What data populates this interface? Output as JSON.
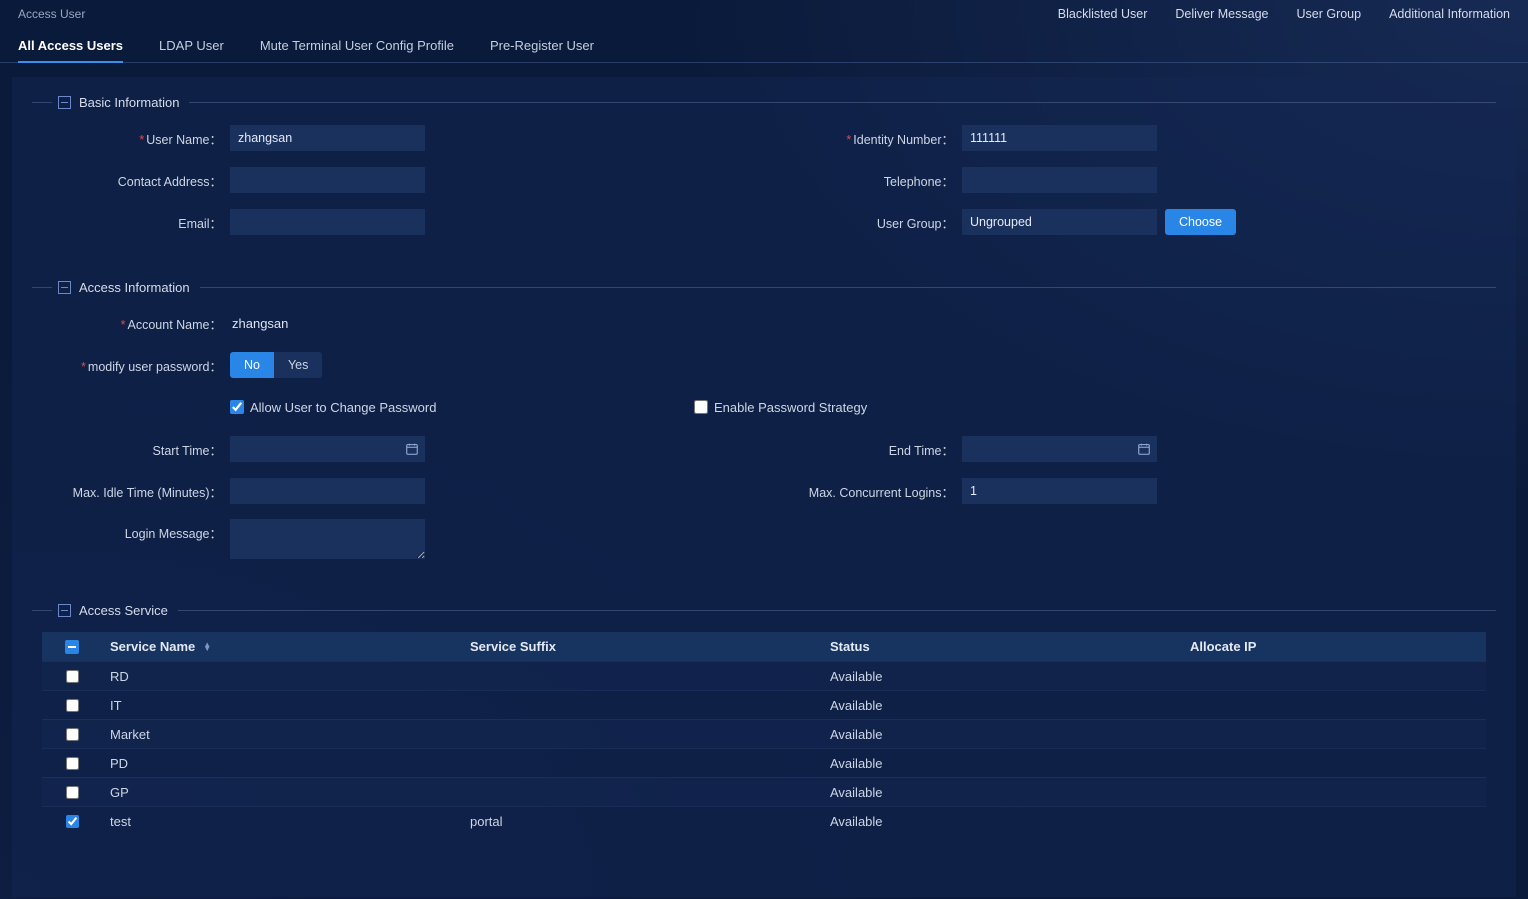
{
  "header": {
    "title": "Access User",
    "links": [
      "Blacklisted User",
      "Deliver Message",
      "User Group",
      "Additional Information"
    ]
  },
  "tabs": [
    "All Access Users",
    "LDAP User",
    "Mute Terminal User Config Profile",
    "Pre-Register User"
  ],
  "activeTab": 0,
  "sections": {
    "basic": {
      "legend": "Basic Information",
      "userNameLabel": "User Name：",
      "userName": "zhangsan",
      "identityLabel": "Identity Number：",
      "identity": "111111",
      "contactLabel": "Contact Address：",
      "contact": "",
      "telLabel": "Telephone：",
      "tel": "",
      "emailLabel": "Email：",
      "email": "",
      "groupLabel": "User Group：",
      "group": "Ungrouped",
      "chooseLabel": "Choose"
    },
    "access": {
      "legend": "Access Information",
      "accountLabel": "Account Name：",
      "account": "zhangsan",
      "modifyLabel": "modify user password：",
      "noLabel": "No",
      "yesLabel": "Yes",
      "allowChangeLabel": "Allow User to Change Password",
      "enableStrategyLabel": "Enable Password Strategy",
      "startLabel": "Start Time：",
      "start": "",
      "endLabel": "End Time：",
      "end": "",
      "maxIdleLabel": "Max. Idle Time (Minutes)：",
      "maxIdle": "",
      "maxConcLabel": "Max. Concurrent Logins：",
      "maxConc": "1",
      "loginMsgLabel": "Login Message：",
      "loginMsg": ""
    },
    "service": {
      "legend": "Access Service",
      "headers": {
        "name": "Service Name",
        "suffix": "Service Suffix",
        "status": "Status",
        "ip": "Allocate IP"
      },
      "rows": [
        {
          "checked": false,
          "name": "RD",
          "suffix": "",
          "status": "Available",
          "ip": ""
        },
        {
          "checked": false,
          "name": "IT",
          "suffix": "",
          "status": "Available",
          "ip": ""
        },
        {
          "checked": false,
          "name": "Market",
          "suffix": "",
          "status": "Available",
          "ip": ""
        },
        {
          "checked": false,
          "name": "PD",
          "suffix": "",
          "status": "Available",
          "ip": ""
        },
        {
          "checked": false,
          "name": "GP",
          "suffix": "",
          "status": "Available",
          "ip": ""
        },
        {
          "checked": true,
          "name": "test",
          "suffix": "portal",
          "status": "Available",
          "ip": ""
        }
      ]
    }
  }
}
